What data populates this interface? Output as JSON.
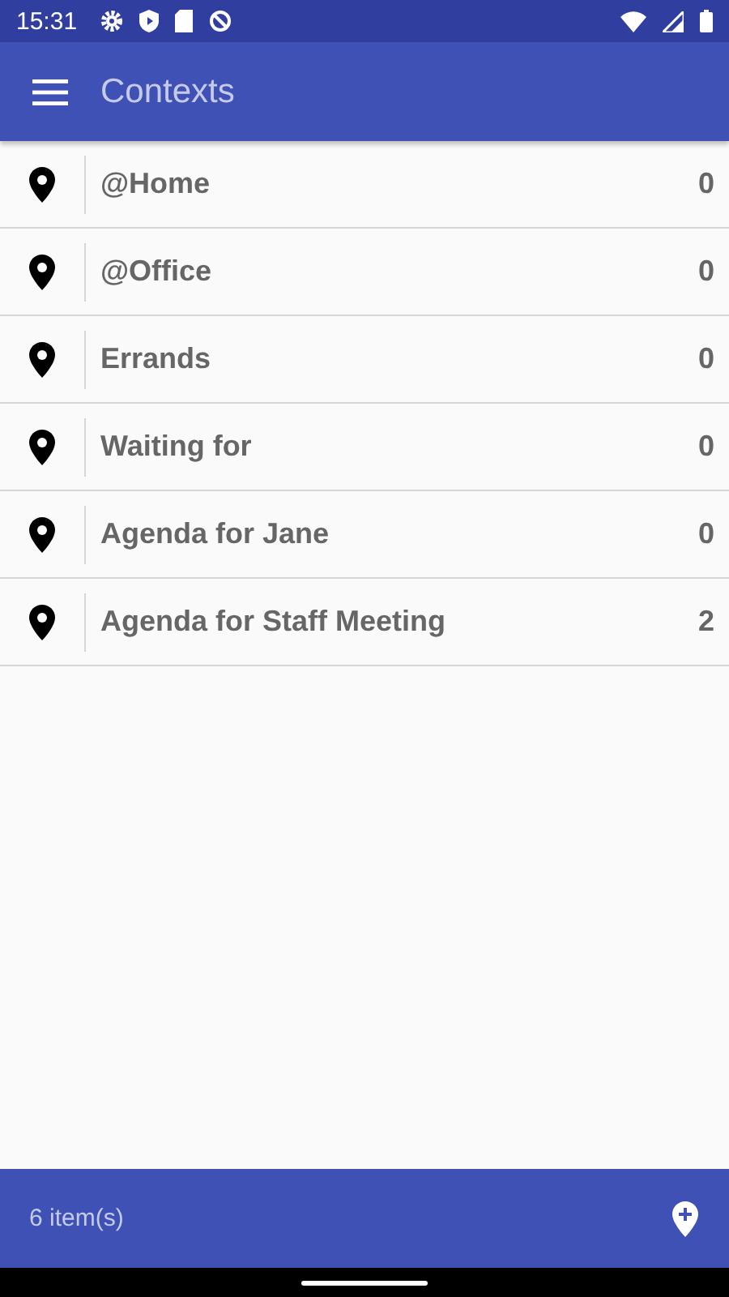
{
  "status_bar": {
    "time": "15:31"
  },
  "app_bar": {
    "title": "Contexts"
  },
  "contexts": [
    {
      "name": "@Home",
      "count": "0"
    },
    {
      "name": "@Office",
      "count": "0"
    },
    {
      "name": "Errands",
      "count": "0"
    },
    {
      "name": "Waiting for",
      "count": "0"
    },
    {
      "name": "Agenda for Jane",
      "count": "0"
    },
    {
      "name": "Agenda for Staff Meeting",
      "count": "2"
    }
  ],
  "footer": {
    "summary": "6 item(s)"
  }
}
